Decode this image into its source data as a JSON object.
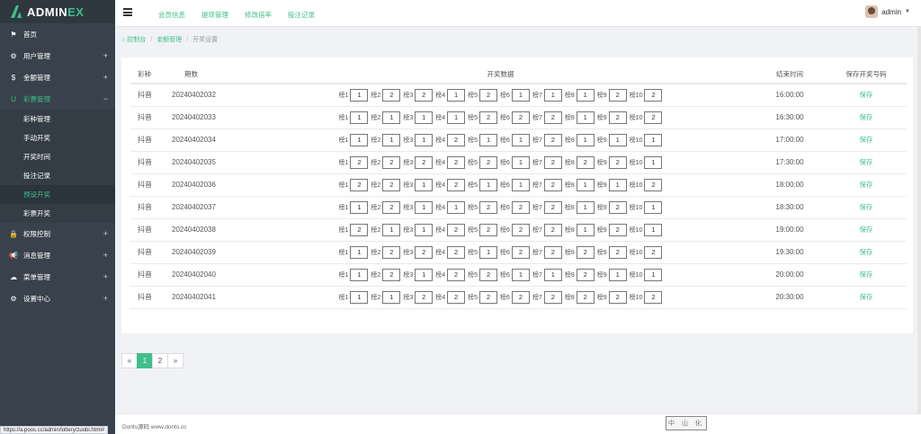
{
  "brand": {
    "prefix": "ADMIN",
    "suffix": "EX"
  },
  "sidebar": {
    "items": [
      {
        "icon": "⚑",
        "icon_name": "flag-icon",
        "label": "首页",
        "plus": ""
      },
      {
        "icon": "⚙",
        "icon_name": "gear-icon",
        "label": "用户管理",
        "plus": "+"
      },
      {
        "icon": "$",
        "icon_name": "dollar-icon",
        "label": "金额管理",
        "plus": "+"
      },
      {
        "icon": "U",
        "icon_name": "magnet-icon",
        "label": "彩票管理",
        "plus": "−"
      }
    ],
    "submenu": [
      "彩种管理",
      "手动开奖",
      "开奖时间",
      "投注记录",
      "预设开奖",
      "彩票开奖"
    ],
    "items_after": [
      {
        "icon": "🔒",
        "icon_name": "lock-icon",
        "label": "权限控制",
        "plus": "+"
      },
      {
        "icon": "📢",
        "icon_name": "bullhorn-icon",
        "label": "消息管理",
        "plus": "+"
      },
      {
        "icon": "☁",
        "icon_name": "cloud-icon",
        "label": "菜单管理",
        "plus": "+"
      },
      {
        "icon": "⚙",
        "icon_name": "cog-icon",
        "label": "设置中心",
        "plus": "+"
      }
    ]
  },
  "topnav": [
    "会员信息",
    "提现管理",
    "修改倍率",
    "投注记录"
  ],
  "user": {
    "name": "admin"
  },
  "breadcrumb": {
    "home": "控制台",
    "section": "金额管理",
    "current": "开奖设置"
  },
  "table": {
    "headers": {
      "type": "彩种",
      "period": "期数",
      "data": "开奖数据",
      "end": "结束时间",
      "save": "保存开奖号码"
    },
    "cell_prefix": "榜",
    "save_label": "保存",
    "rows": [
      {
        "type": "抖音",
        "period": "20240402032",
        "values": [
          "1",
          "2",
          "2",
          "1",
          "2",
          "1",
          "1",
          "1",
          "2",
          "2"
        ],
        "end": "16:00:00"
      },
      {
        "type": "抖音",
        "period": "20240402033",
        "values": [
          "1",
          "1",
          "1",
          "1",
          "2",
          "2",
          "2",
          "1",
          "2",
          "2"
        ],
        "end": "16:30:00"
      },
      {
        "type": "抖音",
        "period": "20240402034",
        "values": [
          "1",
          "1",
          "1",
          "2",
          "1",
          "1",
          "2",
          "1",
          "1",
          "1"
        ],
        "end": "17:00:00"
      },
      {
        "type": "抖音",
        "period": "20240402035",
        "values": [
          "2",
          "2",
          "2",
          "2",
          "2",
          "1",
          "2",
          "2",
          "2",
          "1"
        ],
        "end": "17:30:00"
      },
      {
        "type": "抖音",
        "period": "20240402036",
        "values": [
          "2",
          "2",
          "1",
          "2",
          "1",
          "1",
          "2",
          "1",
          "1",
          "2"
        ],
        "end": "18:00:00"
      },
      {
        "type": "抖音",
        "period": "20240402037",
        "values": [
          "1",
          "2",
          "1",
          "1",
          "2",
          "2",
          "2",
          "1",
          "2",
          "1"
        ],
        "end": "18:30:00"
      },
      {
        "type": "抖音",
        "period": "20240402038",
        "values": [
          "2",
          "1",
          "1",
          "2",
          "2",
          "2",
          "2",
          "1",
          "2",
          "1"
        ],
        "end": "19:00:00"
      },
      {
        "type": "抖音",
        "period": "20240402039",
        "values": [
          "1",
          "2",
          "2",
          "2",
          "1",
          "2",
          "2",
          "2",
          "2",
          "2"
        ],
        "end": "19:30:00"
      },
      {
        "type": "抖音",
        "period": "20240402040",
        "values": [
          "1",
          "2",
          "1",
          "2",
          "2",
          "1",
          "1",
          "2",
          "1",
          "1"
        ],
        "end": "20:00:00"
      },
      {
        "type": "抖音",
        "period": "20240402041",
        "values": [
          "1",
          "1",
          "2",
          "2",
          "2",
          "2",
          "2",
          "2",
          "2",
          "2"
        ],
        "end": "20:30:00"
      }
    ]
  },
  "pagination": {
    "prev": "«",
    "pages": [
      "1",
      "2"
    ],
    "active": "1",
    "next": "»"
  },
  "footer": {
    "text": "Donts源码 www.donts.cc",
    "stamp": "中 山 化"
  },
  "status_url": "https://a.poos.cc/admin/lottery/zuobi.html#",
  "colors": {
    "accent": "#3fbf8a",
    "sidebar": "#39424c"
  }
}
